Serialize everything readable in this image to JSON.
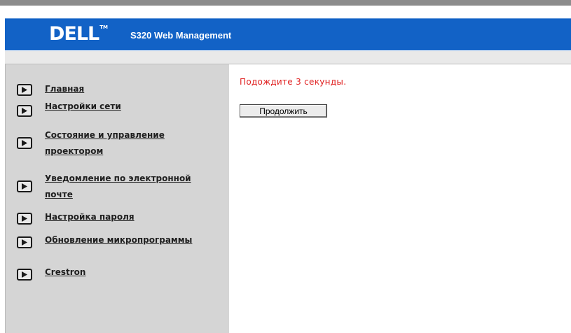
{
  "header": {
    "logo_text": "DELL",
    "logo_tm": "TM",
    "title": "S320 Web Management"
  },
  "sidebar": {
    "items": [
      {
        "lines": [
          "Главная"
        ]
      },
      {
        "lines": [
          "Настройки сети"
        ]
      },
      {
        "lines": [
          "Состояние и управление",
          "проектором"
        ]
      },
      {
        "lines": [
          "Уведомление по электронной",
          "почте"
        ]
      },
      {
        "lines": [
          "Настройка пароля"
        ]
      },
      {
        "lines": [
          "Обновление микропрограммы"
        ]
      },
      {
        "lines": [
          "Crestron"
        ]
      }
    ]
  },
  "main": {
    "wait_message": "Подождите 3 секунды.",
    "continue_label": "Продолжить"
  },
  "icons": {
    "nav_arrow": "play-arrow-icon"
  },
  "colors": {
    "banner": "#1262c6",
    "sidebar": "#d5d5d5",
    "message": "#e02020"
  }
}
